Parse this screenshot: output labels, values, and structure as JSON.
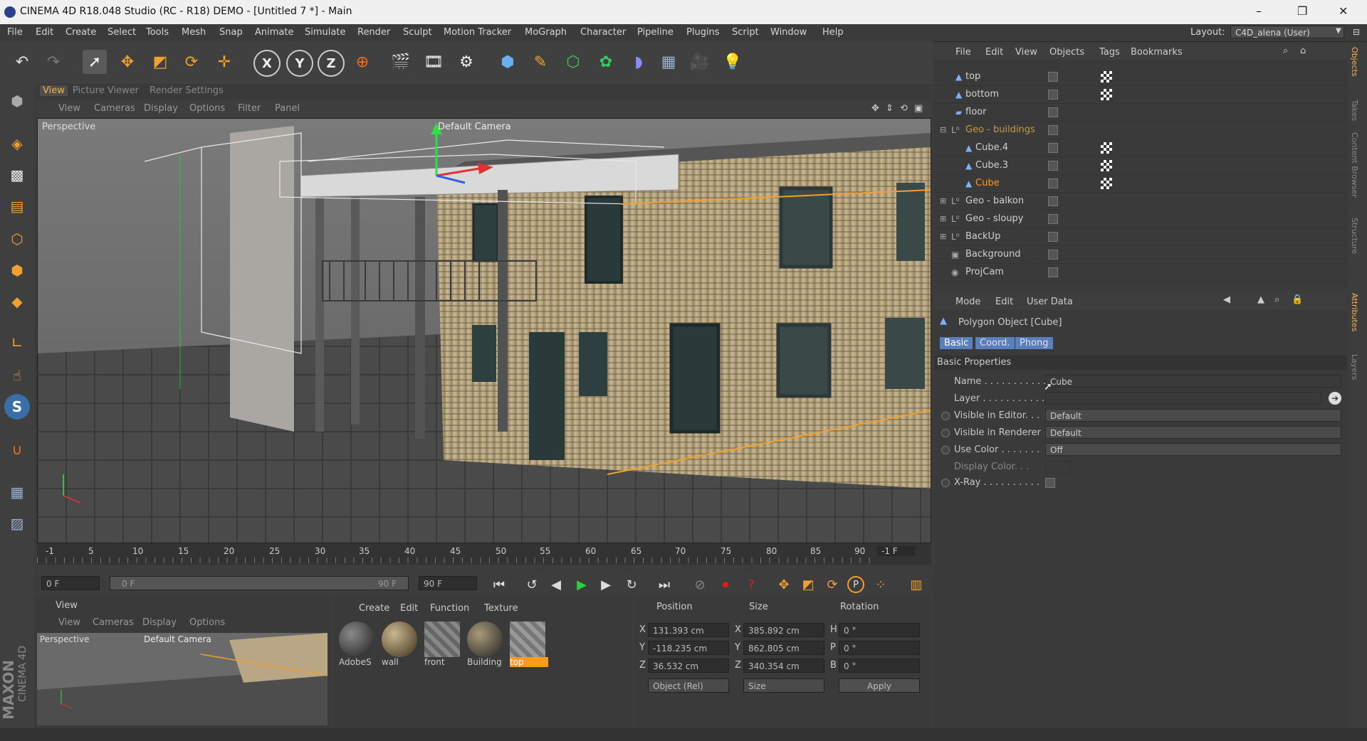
{
  "window": {
    "title": "CINEMA 4D R18.048 Studio (RC - R18) DEMO - [Untitled 7 *] - Main",
    "controls": {
      "minimize": "–",
      "restore": "❐",
      "close": "✕"
    }
  },
  "menubar": {
    "items": [
      "File",
      "Edit",
      "Create",
      "Select",
      "Tools",
      "Mesh",
      "Snap",
      "Animate",
      "Simulate",
      "Render",
      "Sculpt",
      "Motion Tracker",
      "MoGraph",
      "Character",
      "Pipeline",
      "Plugins",
      "Script",
      "Window",
      "Help"
    ],
    "layout_label": "Layout:",
    "layout_value": "C4D_alena (User)"
  },
  "toolbar": {
    "icons": [
      "undo-icon",
      "redo-icon",
      "select-icon",
      "move-icon",
      "scale-icon",
      "rotate-icon",
      "last-tool-icon",
      "x-axis-icon",
      "y-axis-icon",
      "z-axis-icon",
      "world-coords-icon",
      "render-view-icon",
      "render-picture-viewer-icon",
      "render-settings-icon",
      "cube-icon",
      "pen-icon",
      "subdivision-icon",
      "cloner-icon",
      "deformer-icon",
      "floor-icon",
      "camera-icon",
      "light-icon"
    ],
    "axis_labels": {
      "x": "X",
      "y": "Y",
      "z": "Z"
    }
  },
  "left_tools": {
    "icons": [
      "make-editable-icon",
      "model-mode-icon",
      "texture-mode-icon",
      "workplane-icon",
      "points-mode-icon",
      "edges-mode-icon",
      "polygons-mode-icon",
      "axis-mode-icon",
      "tweak-icon",
      "solo-icon",
      "magnet-icon",
      "snap-icon",
      "lock-icon"
    ],
    "snap_label": "S"
  },
  "view_tabs": [
    "View",
    "Picture Viewer",
    "Render Settings"
  ],
  "view_menu": [
    "View",
    "Cameras",
    "Display",
    "Options",
    "Filter",
    "Panel"
  ],
  "viewport": {
    "name": "Perspective",
    "camera": "Default Camera"
  },
  "timeline": {
    "ticks": [
      "-1",
      "5",
      "10",
      "15",
      "20",
      "25",
      "30",
      "35",
      "40",
      "45",
      "50",
      "55",
      "60",
      "65",
      "70",
      "75",
      "80",
      "85",
      "90"
    ],
    "end_label": "-1 F",
    "current_frame": "0 F",
    "range_start": "0 F",
    "range_end": "90 F",
    "max_frame": "90 F"
  },
  "mini_viewport": {
    "title": "View",
    "menu": [
      "View",
      "Cameras",
      "Display",
      "Options"
    ],
    "name": "Perspective",
    "camera": "Default Camera"
  },
  "materials": {
    "menu": [
      "Create",
      "Edit",
      "Function",
      "Texture"
    ],
    "items": [
      "AdobeS",
      "wall",
      "front",
      "Building",
      "top"
    ],
    "selected": "top"
  },
  "coordinates": {
    "headers": [
      "Position",
      "Size",
      "Rotation"
    ],
    "rows": [
      {
        "axis": "X",
        "pos": "131.393 cm",
        "size_axis": "X",
        "size": "385.892 cm",
        "rot_axis": "H",
        "rot": "0 °"
      },
      {
        "axis": "Y",
        "pos": "-118.235 cm",
        "size_axis": "Y",
        "size": "862.805 cm",
        "rot_axis": "P",
        "rot": "0 °"
      },
      {
        "axis": "Z",
        "pos": "36.532 cm",
        "size_axis": "Z",
        "size": "340.354 cm",
        "rot_axis": "B",
        "rot": "0 °"
      }
    ],
    "mode": "Object (Rel)",
    "size_mode": "Size",
    "apply": "Apply"
  },
  "object_manager": {
    "menu": [
      "File",
      "Edit",
      "View",
      "Objects",
      "Tags",
      "Bookmarks"
    ],
    "objects": [
      {
        "name": "top",
        "indent": 0
      },
      {
        "name": "bottom",
        "indent": 0
      },
      {
        "name": "floor",
        "indent": 0
      },
      {
        "name": "Geo - buildings",
        "indent": 0
      },
      {
        "name": "Cube.4",
        "indent": 1
      },
      {
        "name": "Cube.3",
        "indent": 1
      },
      {
        "name": "Cube",
        "indent": 1
      },
      {
        "name": "Geo - balkon",
        "indent": 0
      },
      {
        "name": "Geo - sloupy",
        "indent": 0
      },
      {
        "name": "BackUp",
        "indent": 0
      },
      {
        "name": "Background",
        "indent": 0
      },
      {
        "name": "ProjCam",
        "indent": 0
      }
    ],
    "selected": "Cube"
  },
  "attributes": {
    "menu": [
      "Mode",
      "Edit",
      "User Data"
    ],
    "object_title": "Polygon Object [Cube]",
    "tabs": [
      "Basic",
      "Coord.",
      "Phong"
    ],
    "section": "Basic Properties",
    "name_label": "Name . . . . . . . . . . .",
    "name_value": "Cube",
    "layer_label": "Layer . . . . . . . . . . .",
    "visible_editor_label": "Visible in Editor. . .",
    "visible_editor_value": "Default",
    "visible_renderer_label": "Visible in Renderer",
    "visible_renderer_value": "Default",
    "use_color_label": "Use Color . . . . . . .",
    "use_color_value": "Off",
    "display_color_label": "Display Color. . .",
    "xray_label": "X-Ray . . . . . . . . . ."
  },
  "right_vertical_tabs": [
    "Objects",
    "Takes",
    "Content Browser",
    "Structure",
    "Attributes",
    "Layers"
  ],
  "brand": {
    "line1": "MAXON",
    "line2": "CINEMA 4D"
  },
  "colors": {
    "accent": "#ff9a1a",
    "tab_active": "#5a7fbf",
    "play_green": "#2ecc40",
    "record_red": "#d02020"
  }
}
